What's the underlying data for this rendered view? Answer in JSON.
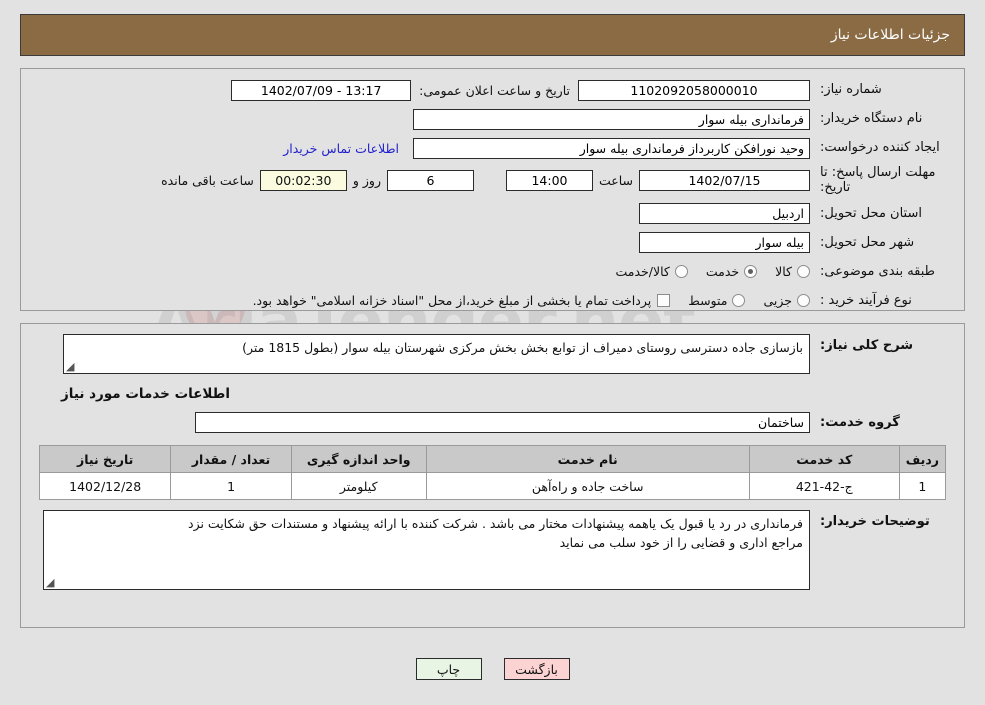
{
  "header": {
    "title": "جزئیات اطلاعات نیاز"
  },
  "watermark": {
    "text": "AriaTender.net",
    "logo": "shield-icon"
  },
  "colors": {
    "header_bg": "#8a6b44",
    "page_bg": "#e2e2e2",
    "link": "#2222cc",
    "countdown_bg": "#fbfbe0",
    "table_header_bg": "#c9c9c9",
    "print_btn_bg": "#e8f5e4",
    "back_btn_bg": "#fbd3d3"
  },
  "form": {
    "need_number_label": "شماره نیاز:",
    "need_number_value": "1102092058000010",
    "announce_date_label": "تاریخ و ساعت اعلان عمومی:",
    "announce_date_value": "1402/07/09 - 13:17",
    "buyer_org_label": "نام دستگاه خریدار:",
    "buyer_org_value": "فرمانداری بیله سوار",
    "creator_label": "ایجاد کننده درخواست:",
    "creator_value": "وحید نورافکن کاربرداز فرمانداری بیله سوار",
    "contact_link": "اطلاعات تماس خریدار",
    "deadline_label": "مهلت ارسال پاسخ: تا تاریخ:",
    "deadline_date_value": "1402/07/15",
    "hour_label": "ساعت",
    "hour_value": "14:00",
    "days_value": "6",
    "days_suffix_label": "روز و",
    "countdown_value": "00:02:30",
    "countdown_suffix_label": "ساعت باقی مانده",
    "province_label": "استان محل تحویل:",
    "province_value": "اردبیل",
    "city_label": "شهر محل تحویل:",
    "city_value": "بیله سوار",
    "category_label": "طبقه بندی موضوعی:",
    "category_options": [
      {
        "label": "کالا",
        "selected": false
      },
      {
        "label": "خدمت",
        "selected": true
      },
      {
        "label": "کالا/خدمت",
        "selected": false
      }
    ],
    "process_label": "نوع فرآیند خرید :",
    "process_options": [
      {
        "label": "جزیی",
        "selected": false
      },
      {
        "label": "متوسط",
        "selected": false
      }
    ],
    "treasury_checkbox_label": "پرداخت تمام یا بخشی از مبلغ خرید،از محل \"اسناد خزانه اسلامی\" خواهد بود.",
    "treasury_checked": false
  },
  "description": {
    "label": "شرح کلی نیاز:",
    "value": "بازسازی جاده دسترسی روستای دمیراف از توابع بخش بخش مرکزی شهرستان بیله سوار (بطول 1815 متر)"
  },
  "services": {
    "section_title": "اطلاعات خدمات مورد نیاز",
    "group_label": "گروه خدمت:",
    "group_value": "ساختمان",
    "table": {
      "columns": [
        "ردیف",
        "کد خدمت",
        "نام خدمت",
        "واحد اندازه گیری",
        "تعداد / مقدار",
        "تاریخ نیاز"
      ],
      "rows": [
        {
          "radif": "1",
          "code": "ج-42-421",
          "name": "ساخت جاده و راه‌آهن",
          "unit": "کیلومتر",
          "qty": "1",
          "date": "1402/12/28"
        }
      ]
    }
  },
  "notes": {
    "label": "توضیحات خریدار:",
    "line1": "فرمانداری در رد یا قبول یک یاهمه پیشنهادات مختار می باشد . شرکت کننده با ارائه پیشنهاد و مستندات حق شکایت نزد",
    "line2": "مراجع اداری و قضایی را از خود سلب می نماید"
  },
  "footer": {
    "print_label": "چاپ",
    "back_label": "بازگشت"
  }
}
